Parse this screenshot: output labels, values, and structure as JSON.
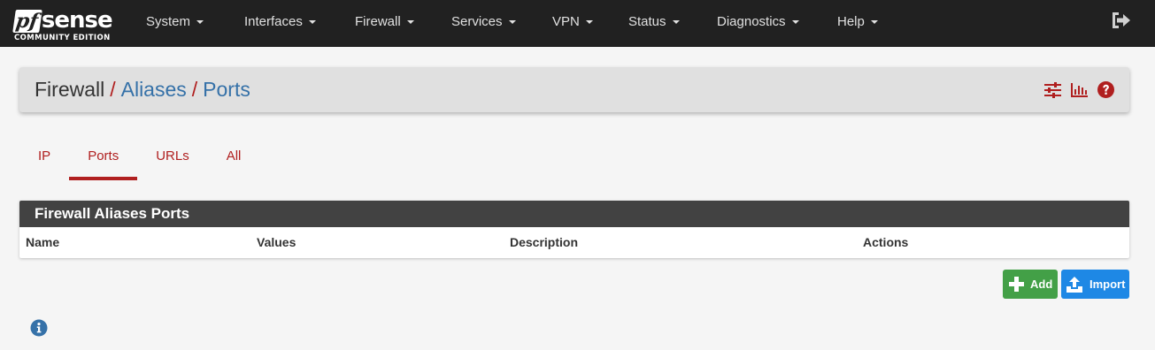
{
  "logo": {
    "prefix": "pf",
    "name": "sense",
    "edition": "COMMUNITY EDITION"
  },
  "nav": {
    "items": [
      {
        "label": "System"
      },
      {
        "label": "Interfaces"
      },
      {
        "label": "Firewall"
      },
      {
        "label": "Services"
      },
      {
        "label": "VPN"
      },
      {
        "label": "Status"
      },
      {
        "label": "Diagnostics"
      },
      {
        "label": "Help"
      }
    ],
    "logout_icon": "sign-out-icon"
  },
  "breadcrumb": {
    "root": "Firewall",
    "separator": "/",
    "level1": "Aliases",
    "level2": "Ports"
  },
  "header_icons": [
    "sliders-icon",
    "bar-chart-icon",
    "question-circle-icon"
  ],
  "tabs": [
    {
      "label": "IP",
      "active": false
    },
    {
      "label": "Ports",
      "active": true
    },
    {
      "label": "URLs",
      "active": false
    },
    {
      "label": "All",
      "active": false
    }
  ],
  "table": {
    "title": "Firewall Aliases Ports",
    "columns": [
      "Name",
      "Values",
      "Description",
      "Actions"
    ],
    "rows": []
  },
  "buttons": {
    "add": {
      "label": "Add",
      "icon": "plus-icon"
    },
    "import": {
      "label": "Import",
      "icon": "upload-icon"
    }
  },
  "info_icon": "info-circle-icon",
  "colors": {
    "navbar": "#212121",
    "accent_red": "#b01f1f",
    "link_blue": "#3571a8",
    "panel_heading": "#424242",
    "add_green": "#43a047",
    "import_blue": "#1e88e5"
  }
}
